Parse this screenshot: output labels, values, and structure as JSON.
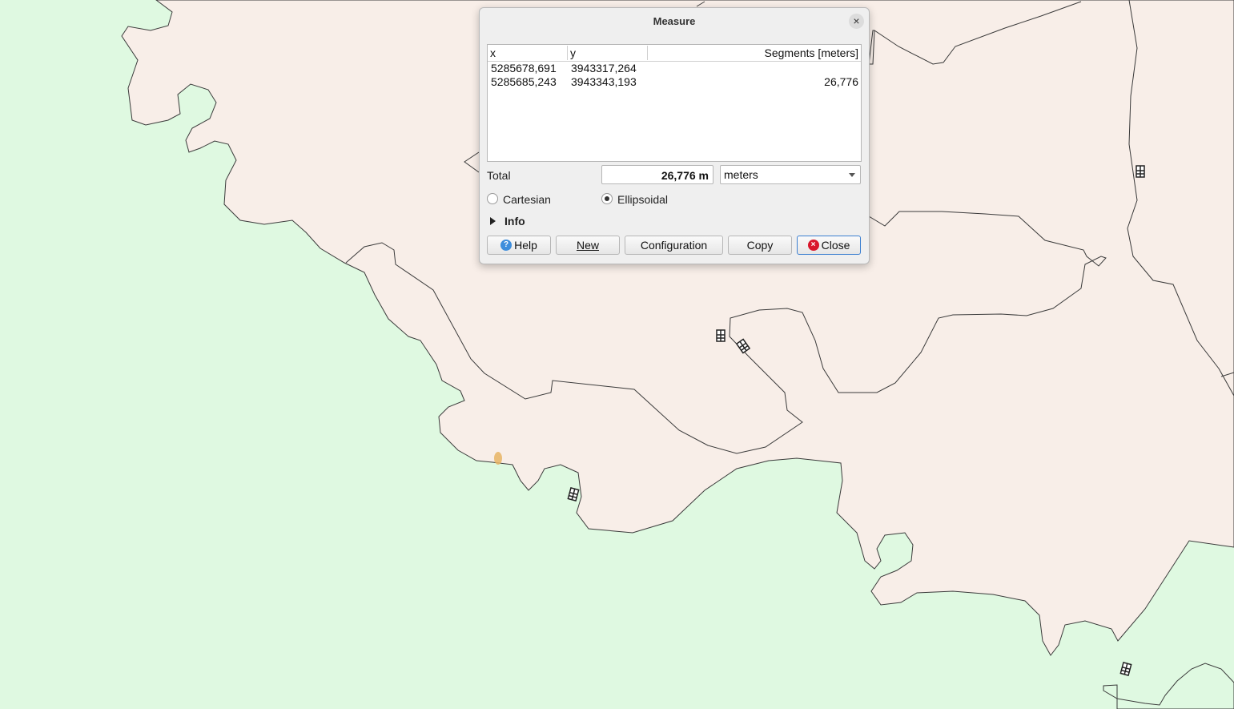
{
  "dialog": {
    "title": "Measure",
    "table": {
      "headers": {
        "x": "x",
        "y": "y",
        "segments": "Segments [meters]"
      },
      "rows": [
        {
          "x": "5285678,691",
          "y": "3943317,264",
          "segment": ""
        },
        {
          "x": "5285685,243",
          "y": "3943343,193",
          "segment": "26,776"
        }
      ]
    },
    "total_label": "Total",
    "total_value": "26,776 m",
    "units_selected": "meters",
    "radio_cartesian": "Cartesian",
    "radio_ellipsoidal": "Ellipsoidal",
    "selected_mode": "Ellipsoidal",
    "info_label": "Info",
    "buttons": {
      "help": "Help",
      "new": "New",
      "configuration": "Configuration",
      "copy": "Copy",
      "close": "Close"
    }
  },
  "map": {
    "land_color": "#f8eee8",
    "forest_color": "#dff9e1",
    "boundary_color": "#3a3a3a",
    "icons": [
      "building-icon",
      "building-icon",
      "building-icon",
      "building-icon",
      "building-icon"
    ]
  },
  "colors": {
    "help_icon": "#3e8edc",
    "close_icon": "#d9162b",
    "measure_marker": "#e8b464"
  }
}
